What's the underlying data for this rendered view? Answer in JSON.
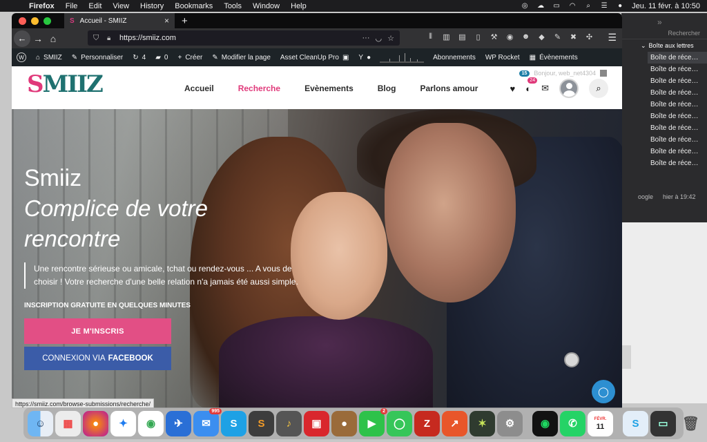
{
  "menubar": {
    "app_name": "Firefox",
    "items": [
      "File",
      "Edit",
      "View",
      "History",
      "Bookmarks",
      "Tools",
      "Window",
      "Help"
    ],
    "clock": "Jeu. 11 févr. à 10:50"
  },
  "mail_window": {
    "search_label": "Rechercher",
    "folder": "Boîte aux lettres",
    "rows": [
      "Boîte de réce…",
      "Boîte de réce…",
      "Boîte de réce…",
      "Boîte de réce…",
      "Boîte de réce…",
      "Boîte de réce…",
      "Boîte de réce…",
      "Boîte de réce…",
      "Boîte de réce…",
      "Boîte de réce…"
    ],
    "meta_source": "oogle",
    "meta_time": "hier à 19:42"
  },
  "browser": {
    "tab_title": "Accueil - SMIIZ",
    "url": "https://smiiz.com",
    "status_url": "https://smiiz.com/browse-submissions/recherche/"
  },
  "wpbar": {
    "site_name": "SMIIZ",
    "customize": "Personnaliser",
    "updates": "4",
    "comments": "0",
    "new": "Créer",
    "edit_page": "Modifier la page",
    "asset": "Asset CleanUp Pro",
    "subscriptions": "Abonnements",
    "wp_rocket": "WP Rocket",
    "events": "Évènements"
  },
  "site": {
    "logo_pink": "S",
    "logo_teal": "MIIZ",
    "nav": [
      "Accueil",
      "Recherche",
      "Evènements",
      "Blog",
      "Parlons amour"
    ],
    "active_nav": "Recherche",
    "greeting": "Bonjour, web_net4304",
    "greeting_badge": "15",
    "notif_count": "24"
  },
  "hero": {
    "title": "Smiiz",
    "subtitle_line1": "Complice de votre",
    "subtitle_line2": "rencontre",
    "description": "Une rencontre sérieuse ou amicale, tchat ou rendez-vous ... A vous de choisir ! Votre recherche d'une belle relation n'a jamais été aussi simple.",
    "inscription": "INSCRIPTION GRATUITE EN QUELQUES MINUTES",
    "signup_button": "JE M'INSCRIS",
    "facebook_prefix": "CONNEXION VIA",
    "facebook_brand": "FACEBOOK"
  },
  "dock": {
    "mail_badge": "995",
    "facetime_badge": "2",
    "calendar_month": "FÉVR.",
    "calendar_day": "11"
  },
  "colors": {
    "brand_pink": "#e0397a",
    "brand_teal": "#1f7170",
    "facebook": "#3b5ca8"
  }
}
